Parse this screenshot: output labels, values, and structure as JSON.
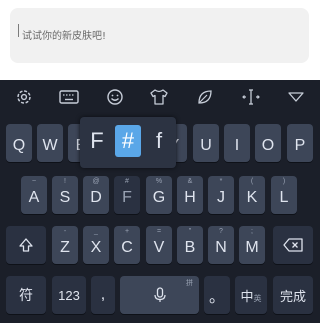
{
  "preview": {
    "text": "试试你的新皮肤吧!"
  },
  "toolbar": {
    "icons": [
      "gear-icon",
      "keyboard-icon",
      "emoji-icon",
      "shirt-icon",
      "leaf-icon",
      "cursor-move-icon",
      "collapse-icon"
    ]
  },
  "popup": {
    "items": [
      "F",
      "#",
      "f"
    ],
    "selected_index": 1
  },
  "rows": {
    "row1": [
      {
        "main": "Q",
        "sub": ""
      },
      {
        "main": "W",
        "sub": ""
      },
      {
        "main": "E",
        "sub": ""
      },
      {
        "main": "R",
        "sub": ""
      },
      {
        "main": "T",
        "sub": ""
      },
      {
        "main": "Y",
        "sub": ""
      },
      {
        "main": "U",
        "sub": ""
      },
      {
        "main": "I",
        "sub": ""
      },
      {
        "main": "O",
        "sub": ""
      },
      {
        "main": "P",
        "sub": ""
      }
    ],
    "row2": [
      {
        "main": "A",
        "sub": "~"
      },
      {
        "main": "S",
        "sub": "!"
      },
      {
        "main": "D",
        "sub": "@"
      },
      {
        "main": "F",
        "sub": "#"
      },
      {
        "main": "G",
        "sub": "%"
      },
      {
        "main": "H",
        "sub": "&"
      },
      {
        "main": "J",
        "sub": "*"
      },
      {
        "main": "K",
        "sub": "("
      },
      {
        "main": "L",
        "sub": ")"
      }
    ],
    "row3": [
      {
        "main": "Z",
        "sub": "-"
      },
      {
        "main": "X",
        "sub": "_"
      },
      {
        "main": "C",
        "sub": "+"
      },
      {
        "main": "V",
        "sub": "="
      },
      {
        "main": "B",
        "sub": "\""
      },
      {
        "main": "N",
        "sub": "?"
      },
      {
        "main": "M",
        "sub": ";"
      }
    ]
  },
  "bottom": {
    "symbols_label": "符",
    "numbers_label": "123",
    "comma_label": ",",
    "space_hint": "拼",
    "period_label": "。",
    "lang_label": "中",
    "lang_sub": "英",
    "done_label": "完成"
  },
  "colors": {
    "keyboard_bg": "#1b1f29",
    "key_bg": "#3d4658",
    "key_text": "#dfe4ee",
    "accent": "#5aa7e8"
  }
}
